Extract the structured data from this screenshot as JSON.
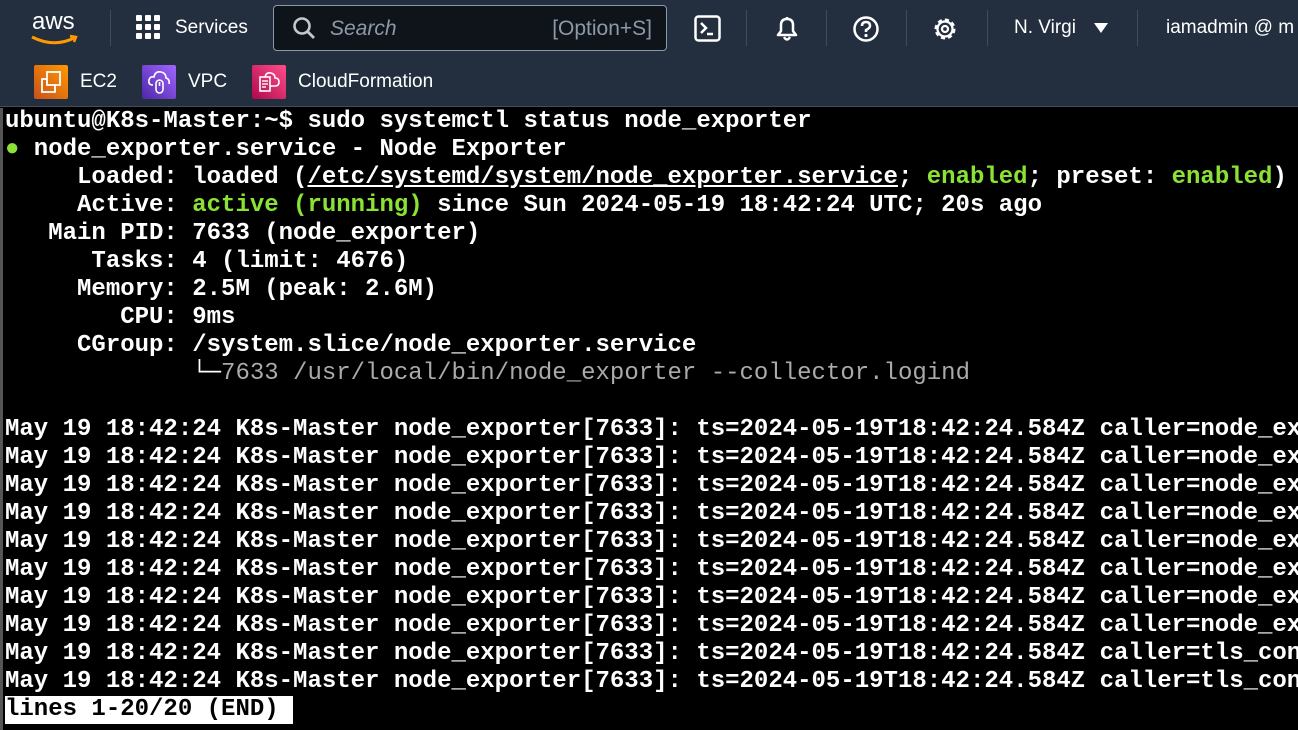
{
  "nav": {
    "logo": "aws",
    "services_label": "Services",
    "search_placeholder": "Search",
    "search_shortcut": "[Option+S]",
    "region": "N. Virgi",
    "account": "iamadmin @ m",
    "icons": [
      "cloudshell-icon",
      "bell-icon",
      "help-icon",
      "gear-icon"
    ]
  },
  "favorites": [
    {
      "label": "EC2",
      "color": "#e07b1a"
    },
    {
      "label": "VPC",
      "color": "#8c4fff"
    },
    {
      "label": "CloudFormation",
      "color": "#e7157b"
    }
  ],
  "terminal": {
    "lines": [
      [
        {
          "t": "ubuntu@K8s-Master:~$ sudo systemctl status node_exporter",
          "c": ""
        }
      ],
      [
        {
          "t": "●",
          "c": "g"
        },
        {
          "t": " node_exporter.service - Node Exporter",
          "c": ""
        }
      ],
      [
        {
          "t": "     Loaded: loaded (",
          "c": ""
        },
        {
          "t": "/etc/systemd/system/node_exporter.service",
          "c": "u"
        },
        {
          "t": "; ",
          "c": ""
        },
        {
          "t": "enabled",
          "c": "g"
        },
        {
          "t": "; preset: ",
          "c": ""
        },
        {
          "t": "enabled",
          "c": "g"
        },
        {
          "t": ")",
          "c": ""
        }
      ],
      [
        {
          "t": "     Active: ",
          "c": ""
        },
        {
          "t": "active (running)",
          "c": "g"
        },
        {
          "t": " since Sun 2024-05-19 18:42:24 UTC; 20s ago",
          "c": ""
        }
      ],
      [
        {
          "t": "   Main PID: 7633 (node_exporter)",
          "c": ""
        }
      ],
      [
        {
          "t": "      Tasks: 4 (limit: 4676)",
          "c": ""
        }
      ],
      [
        {
          "t": "     Memory: 2.5M (peak: 2.6M)",
          "c": ""
        }
      ],
      [
        {
          "t": "        CPU: 9ms",
          "c": ""
        }
      ],
      [
        {
          "t": "     CGroup: /system.slice/node_exporter.service",
          "c": ""
        }
      ],
      [
        {
          "t": "             └─",
          "c": ""
        },
        {
          "t": "7633 /usr/local/bin/node_exporter --collector.logind",
          "c": "dim"
        }
      ],
      [
        {
          "t": "",
          "c": ""
        }
      ],
      [
        {
          "t": "May 19 18:42:24 K8s-Master node_exporter[7633]: ts=2024-05-19T18:42:24.584Z caller=node_ex",
          "c": ""
        }
      ],
      [
        {
          "t": "May 19 18:42:24 K8s-Master node_exporter[7633]: ts=2024-05-19T18:42:24.584Z caller=node_ex",
          "c": ""
        }
      ],
      [
        {
          "t": "May 19 18:42:24 K8s-Master node_exporter[7633]: ts=2024-05-19T18:42:24.584Z caller=node_ex",
          "c": ""
        }
      ],
      [
        {
          "t": "May 19 18:42:24 K8s-Master node_exporter[7633]: ts=2024-05-19T18:42:24.584Z caller=node_ex",
          "c": ""
        }
      ],
      [
        {
          "t": "May 19 18:42:24 K8s-Master node_exporter[7633]: ts=2024-05-19T18:42:24.584Z caller=node_ex",
          "c": ""
        }
      ],
      [
        {
          "t": "May 19 18:42:24 K8s-Master node_exporter[7633]: ts=2024-05-19T18:42:24.584Z caller=node_ex",
          "c": ""
        }
      ],
      [
        {
          "t": "May 19 18:42:24 K8s-Master node_exporter[7633]: ts=2024-05-19T18:42:24.584Z caller=node_ex",
          "c": ""
        }
      ],
      [
        {
          "t": "May 19 18:42:24 K8s-Master node_exporter[7633]: ts=2024-05-19T18:42:24.584Z caller=node_ex",
          "c": ""
        }
      ],
      [
        {
          "t": "May 19 18:42:24 K8s-Master node_exporter[7633]: ts=2024-05-19T18:42:24.584Z caller=tls_con",
          "c": ""
        }
      ],
      [
        {
          "t": "May 19 18:42:24 K8s-Master node_exporter[7633]: ts=2024-05-19T18:42:24.584Z caller=tls_con",
          "c": ""
        }
      ]
    ],
    "pager_status": "lines 1-20/20 (END)"
  }
}
